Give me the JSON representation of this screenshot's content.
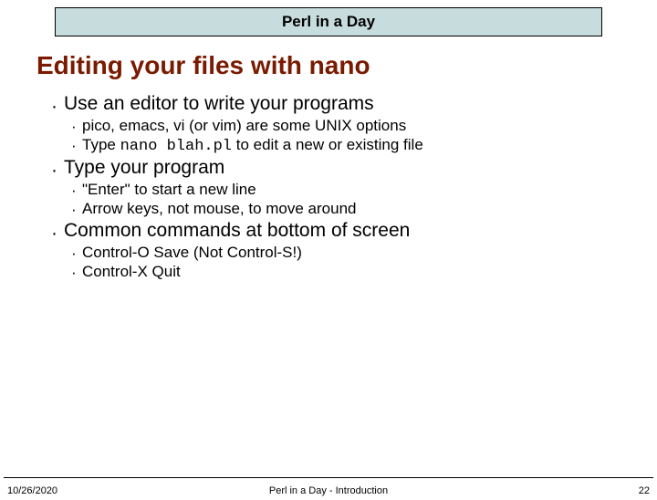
{
  "header": "Perl in a Day",
  "title": "Editing your files with nano",
  "bullets": [
    {
      "text": "Use an editor to write your programs",
      "sub": [
        {
          "text": "pico, emacs, vi (or vim) are some UNIX options"
        },
        {
          "prefix": "Type ",
          "mono": "nano blah.pl",
          "suffix": " to edit a new or existing file"
        }
      ]
    },
    {
      "text": "Type your program",
      "sub": [
        {
          "text": "\"Enter\" to start a new line"
        },
        {
          "text": "Arrow keys, not mouse, to move around"
        }
      ]
    },
    {
      "text": "Common commands at bottom of screen",
      "sub": [
        {
          "text": "Control-O  Save   (Not Control-S!)"
        },
        {
          "text": "Control-X  Quit"
        }
      ]
    }
  ],
  "footer": {
    "date": "10/26/2020",
    "title": "Perl in a Day - Introduction",
    "page": "22"
  }
}
